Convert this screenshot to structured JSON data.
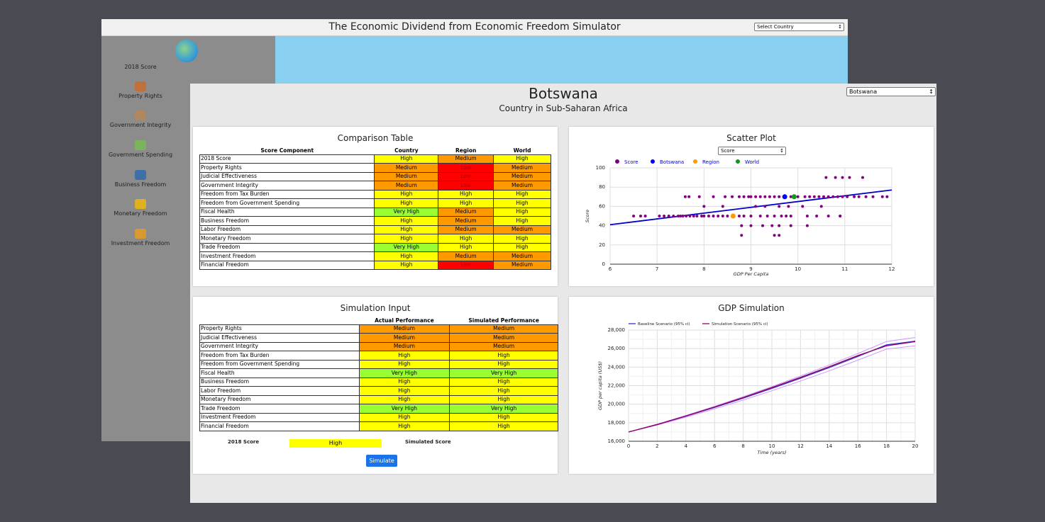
{
  "back_window": {
    "title": "The Economic Dividend from Economic Freedom Simulator",
    "select_country": "Select Country",
    "sidebar": {
      "score_label": "2018 Score",
      "items": [
        {
          "label": "Property Rights",
          "icon": "house-icon"
        },
        {
          "label": "Government Integrity",
          "icon": "courthouse-icon"
        },
        {
          "label": "Government Spending",
          "icon": "money-hand-icon"
        },
        {
          "label": "Business Freedom",
          "icon": "handshake-icon"
        },
        {
          "label": "Monetary Freedom",
          "icon": "wallet-icon"
        },
        {
          "label": "Investment Freedom",
          "icon": "chart-bars-icon"
        }
      ]
    }
  },
  "front_window": {
    "country": "Botswana",
    "subtitle": "Country in Sub-Saharan Africa",
    "country_select": "Botswana"
  },
  "colors": {
    "High": "#ffff00",
    "Medium": "#ff9900",
    "Low": "#ff0000",
    "Very High": "#99ff33",
    "button": "#1a73e8"
  },
  "comparison": {
    "title": "Comparison Table",
    "headers": [
      "Score Component",
      "Country",
      "Region",
      "World"
    ],
    "rows": [
      {
        "name": "2018 Score",
        "country": "High",
        "region": "Medium",
        "world": "High"
      },
      {
        "name": "Property Rights",
        "country": "Medium",
        "region": "Low",
        "world": "Medium"
      },
      {
        "name": "Judicial Effectiveness",
        "country": "Medium",
        "region": "Low",
        "world": "Medium"
      },
      {
        "name": "Government Integrity",
        "country": "Medium",
        "region": "Low",
        "world": "Medium"
      },
      {
        "name": "Freedom from Tax Burden",
        "country": "High",
        "region": "High",
        "world": "High"
      },
      {
        "name": "Freedom from Government Spending",
        "country": "High",
        "region": "High",
        "world": "High"
      },
      {
        "name": "Fiscal Health",
        "country": "Very High",
        "region": "Medium",
        "world": "High"
      },
      {
        "name": "Business Freedom",
        "country": "High",
        "region": "Medium",
        "world": "High"
      },
      {
        "name": "Labor Freedom",
        "country": "High",
        "region": "Medium",
        "world": "Medium"
      },
      {
        "name": "Monetary Freedom",
        "country": "High",
        "region": "High",
        "world": "High"
      },
      {
        "name": "Trade Freedom",
        "country": "Very High",
        "region": "High",
        "world": "High"
      },
      {
        "name": "Investment Freedom",
        "country": "High",
        "region": "Medium",
        "world": "Medium"
      },
      {
        "name": "Financial Freedom",
        "country": "High",
        "region": "Low",
        "world": "Medium"
      }
    ]
  },
  "scatter": {
    "title": "Scatter Plot",
    "select": "Score",
    "legend": [
      "Score",
      "Botswana",
      "Region",
      "World"
    ],
    "legend_colors": [
      "#800080",
      "#0000ff",
      "#ff9900",
      "#109618"
    ]
  },
  "simulation": {
    "title": "Simulation Input",
    "headers": [
      "Actual Performance",
      "Simulated Performance"
    ],
    "rows": [
      {
        "name": "Property Rights",
        "actual": "Medium",
        "simulated": "Medium"
      },
      {
        "name": "Judicial Effectiveness",
        "actual": "Medium",
        "simulated": "Medium"
      },
      {
        "name": "Government Integrity",
        "actual": "Medium",
        "simulated": "Medium"
      },
      {
        "name": "Freedom from Tax Burden",
        "actual": "High",
        "simulated": "High"
      },
      {
        "name": "Freedom from Government Spending",
        "actual": "High",
        "simulated": "High"
      },
      {
        "name": "Fiscal Health",
        "actual": "Very High",
        "simulated": "Very High"
      },
      {
        "name": "Business Freedom",
        "actual": "High",
        "simulated": "High"
      },
      {
        "name": "Labor Freedom",
        "actual": "High",
        "simulated": "High"
      },
      {
        "name": "Monetary Freedom",
        "actual": "High",
        "simulated": "High"
      },
      {
        "name": "Trade Freedom",
        "actual": "Very High",
        "simulated": "Very High"
      },
      {
        "name": "Investment Freedom",
        "actual": "High",
        "simulated": "High"
      },
      {
        "name": "Financial Freedom",
        "actual": "High",
        "simulated": "High"
      }
    ],
    "score_label": "2018 Score",
    "score_value": "High",
    "simulated_label": "Simulated Score",
    "button": "Simulate"
  },
  "gdp": {
    "title": "GDP Simulation"
  },
  "chart_data": [
    {
      "type": "scatter",
      "title": "Scatter Plot",
      "xlabel": "GDP Per Capita",
      "ylabel": "Score",
      "xlim": [
        6,
        12
      ],
      "ylim": [
        0,
        100
      ],
      "xticks": [
        "6",
        "7",
        "8",
        "9",
        "10",
        "11",
        "12"
      ],
      "yticks": [
        "0",
        "20",
        "40",
        "60",
        "80",
        "100"
      ],
      "grid": true,
      "legend_position": "top",
      "series": [
        {
          "name": "Score",
          "color": "#800080",
          "points": [
            [
              6.5,
              50
            ],
            [
              6.65,
              50
            ],
            [
              6.75,
              50
            ],
            [
              7.05,
              50
            ],
            [
              7.15,
              50
            ],
            [
              7.25,
              50
            ],
            [
              7.35,
              50
            ],
            [
              7.45,
              50
            ],
            [
              7.5,
              50
            ],
            [
              7.55,
              50
            ],
            [
              7.62,
              50
            ],
            [
              7.7,
              50
            ],
            [
              7.78,
              50
            ],
            [
              7.85,
              50
            ],
            [
              7.95,
              50
            ],
            [
              8.0,
              50
            ],
            [
              8.1,
              50
            ],
            [
              8.2,
              50
            ],
            [
              8.3,
              50
            ],
            [
              8.4,
              50
            ],
            [
              8.5,
              50
            ],
            [
              8.6,
              50
            ],
            [
              8.75,
              50
            ],
            [
              8.85,
              50
            ],
            [
              9.0,
              50
            ],
            [
              9.2,
              50
            ],
            [
              9.35,
              50
            ],
            [
              9.5,
              50
            ],
            [
              9.65,
              50
            ],
            [
              9.75,
              50
            ],
            [
              9.85,
              50
            ],
            [
              10.2,
              50
            ],
            [
              10.4,
              50
            ],
            [
              10.65,
              50
            ],
            [
              10.9,
              50
            ],
            [
              7.6,
              70
            ],
            [
              7.68,
              70
            ],
            [
              7.9,
              70
            ],
            [
              8.2,
              70
            ],
            [
              8.45,
              70
            ],
            [
              8.6,
              70
            ],
            [
              8.75,
              70
            ],
            [
              8.85,
              70
            ],
            [
              8.95,
              70
            ],
            [
              9.0,
              70
            ],
            [
              9.1,
              70
            ],
            [
              9.2,
              70
            ],
            [
              9.3,
              70
            ],
            [
              9.4,
              70
            ],
            [
              9.5,
              70
            ],
            [
              9.6,
              70
            ],
            [
              9.85,
              70
            ],
            [
              10.0,
              70
            ],
            [
              10.15,
              70
            ],
            [
              10.25,
              70
            ],
            [
              10.35,
              70
            ],
            [
              10.45,
              70
            ],
            [
              10.55,
              70
            ],
            [
              10.65,
              70
            ],
            [
              10.75,
              70
            ],
            [
              10.85,
              70
            ],
            [
              10.95,
              70
            ],
            [
              11.05,
              70
            ],
            [
              11.2,
              70
            ],
            [
              11.3,
              70
            ],
            [
              11.45,
              70
            ],
            [
              11.6,
              70
            ],
            [
              11.8,
              70
            ],
            [
              8.0,
              60
            ],
            [
              8.4,
              60
            ],
            [
              9.1,
              60
            ],
            [
              9.3,
              60
            ],
            [
              9.6,
              60
            ],
            [
              9.8,
              60
            ],
            [
              10.1,
              60
            ],
            [
              10.5,
              60
            ],
            [
              8.8,
              40
            ],
            [
              9.0,
              40
            ],
            [
              9.25,
              40
            ],
            [
              9.45,
              40
            ],
            [
              9.6,
              40
            ],
            [
              9.85,
              40
            ],
            [
              10.2,
              40
            ],
            [
              8.8,
              30
            ],
            [
              9.5,
              30
            ],
            [
              9.6,
              30
            ],
            [
              10.6,
              90
            ],
            [
              10.8,
              90
            ],
            [
              10.95,
              90
            ],
            [
              11.1,
              90
            ],
            [
              11.38,
              90
            ],
            [
              11.9,
              70
            ],
            [
              10.9,
              50
            ]
          ]
        },
        {
          "name": "Botswana",
          "color": "#0000ff",
          "points": [
            [
              9.72,
              70
            ]
          ]
        },
        {
          "name": "Region",
          "color": "#ff9900",
          "points": [
            [
              8.62,
              50
            ]
          ]
        },
        {
          "name": "World",
          "color": "#109618",
          "points": [
            [
              9.92,
              70
            ]
          ]
        }
      ],
      "trendline": {
        "color": "#0000cc",
        "from": [
          6,
          41
        ],
        "to": [
          12,
          77
        ]
      }
    },
    {
      "type": "line",
      "title": "GDP Simulation",
      "xlabel": "Time (years)",
      "ylabel": "GDP per capita (US$)",
      "xlim": [
        0,
        20
      ],
      "ylim": [
        16000,
        28000
      ],
      "xticks": [
        "0",
        "2",
        "4",
        "6",
        "8",
        "10",
        "12",
        "14",
        "16",
        "18",
        "20"
      ],
      "yticks": [
        "16,000",
        "18,000",
        "20,000",
        "22,000",
        "24,000",
        "26,000",
        "28,000"
      ],
      "grid": true,
      "legend_position": "top-left",
      "x": [
        0,
        2,
        4,
        6,
        8,
        10,
        12,
        14,
        16,
        18,
        20
      ],
      "series": [
        {
          "name": "Baseline Scenario (95% ci)",
          "color": "#3333cc",
          "values": [
            17000,
            17800,
            18700,
            19650,
            20650,
            21700,
            22800,
            23950,
            25150,
            26400,
            26800
          ]
        },
        {
          "name": "Simulation Scenario (95% ci)",
          "color": "#990066",
          "values": [
            17000,
            17820,
            18730,
            19700,
            20720,
            21800,
            22900,
            24050,
            25250,
            26300,
            26750
          ]
        }
      ],
      "bands": {
        "color": "#cc99ff",
        "upper_end": 27200,
        "lower_end": 26300
      }
    }
  ]
}
